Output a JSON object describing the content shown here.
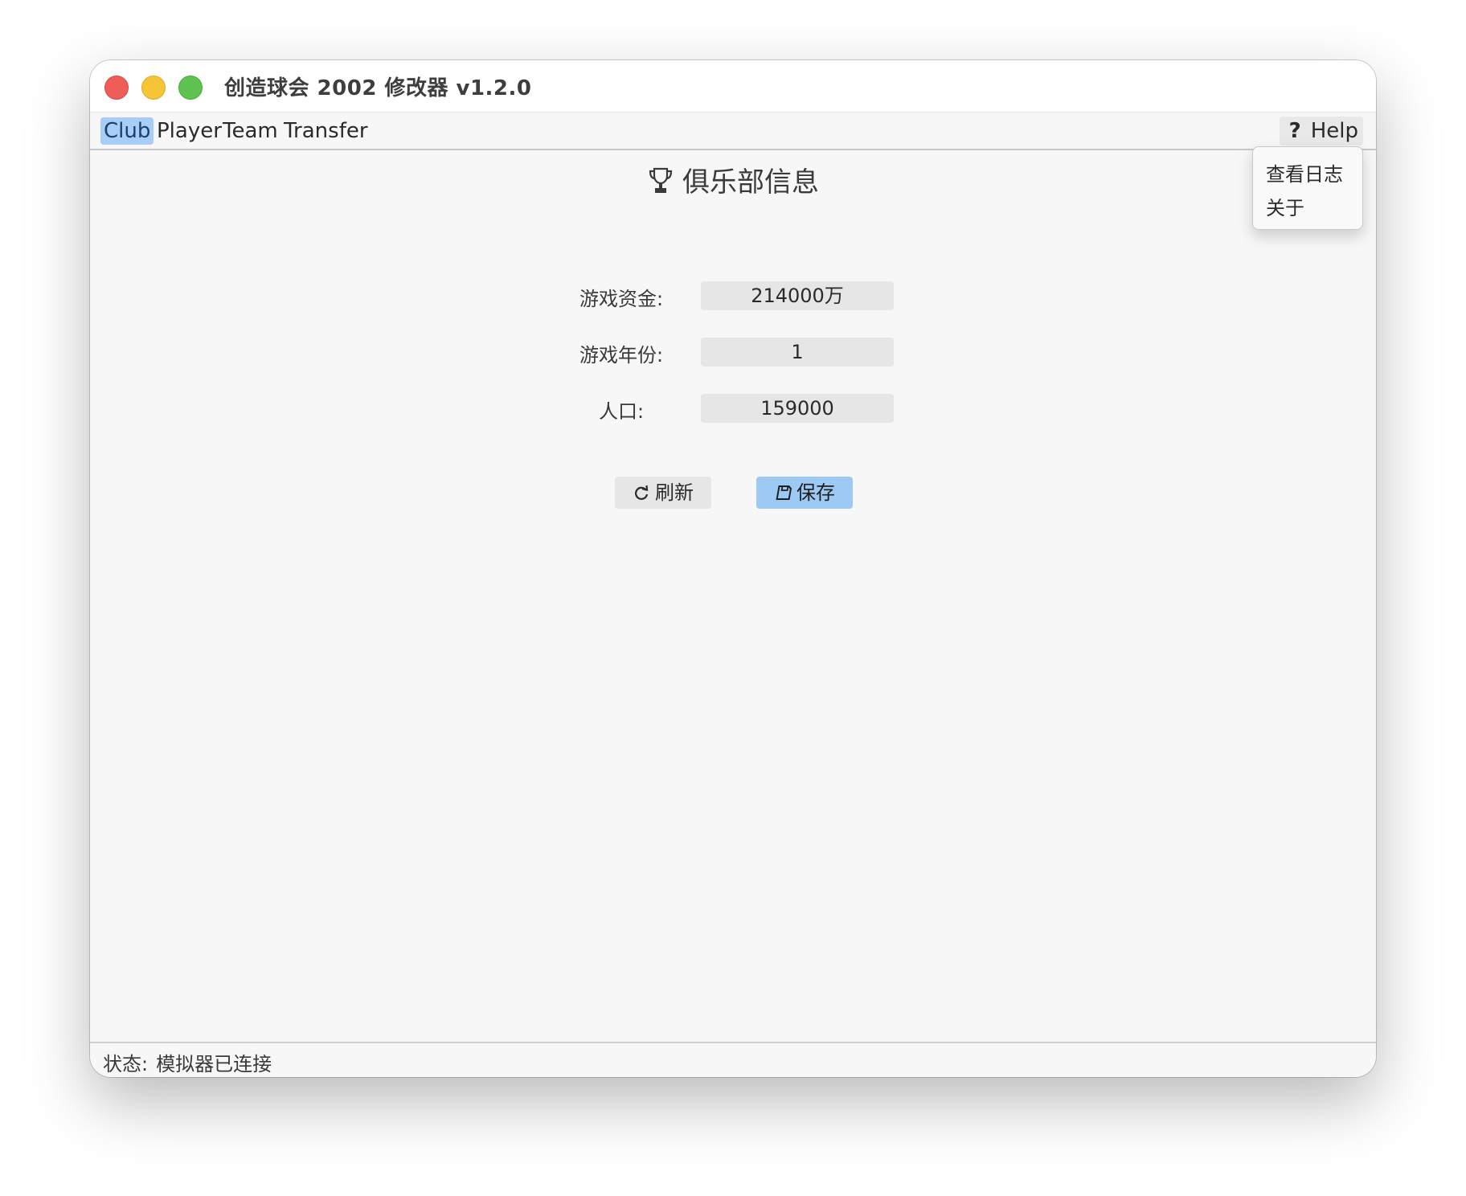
{
  "window": {
    "title": "创造球会 2002 修改器 v1.2.0"
  },
  "menubar": {
    "items": [
      {
        "label": "Club",
        "active": true
      },
      {
        "label": "Player",
        "active": false
      },
      {
        "label": "Team",
        "active": false
      },
      {
        "label": "Transfer",
        "active": false
      }
    ],
    "help": {
      "icon": "question-mark-icon",
      "icon_glyph": "?",
      "label": "Help",
      "dropdown": [
        "查看日志",
        "关于"
      ]
    }
  },
  "main": {
    "heading": "俱乐部信息",
    "heading_icon": "trophy-icon",
    "fields": [
      {
        "label": "游戏资金:",
        "value": "214000万"
      },
      {
        "label": "游戏年份:",
        "value": "1"
      },
      {
        "label": "人口:",
        "value": "159000"
      }
    ],
    "buttons": {
      "refresh": {
        "label": "刷新",
        "icon": "refresh-icon"
      },
      "save": {
        "label": "保存",
        "icon": "floppy-disk-icon"
      }
    }
  },
  "statusbar": {
    "label": "状态:",
    "value": "模拟器已连接"
  },
  "colors": {
    "accent": "#a6cef7",
    "save_button": "#9ccaf5",
    "close": "#ee5d57",
    "minimize": "#f5c537",
    "maximize": "#5fc352"
  }
}
